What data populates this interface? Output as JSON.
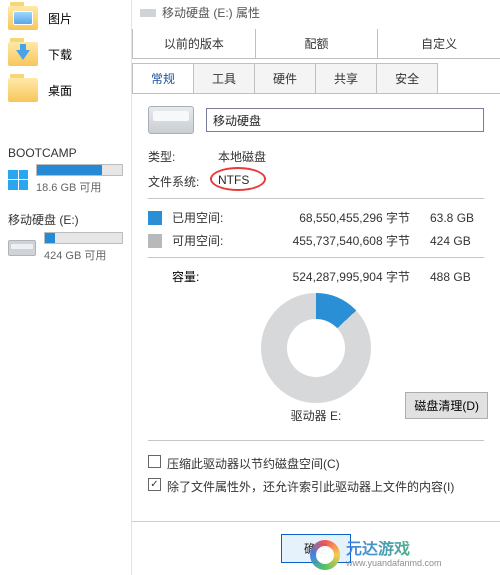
{
  "sidebar": {
    "items": [
      {
        "label": "图片"
      },
      {
        "label": "下载"
      },
      {
        "label": "桌面"
      }
    ],
    "drives": [
      {
        "name": "BOOTCAMP",
        "free_text": "18.6 GB 可用",
        "used_pct": 76,
        "os": true
      },
      {
        "name": "移动硬盘 (E:)",
        "free_text": "424 GB 可用",
        "used_pct": 13,
        "selected": true
      }
    ]
  },
  "dialog": {
    "title": "移动硬盘 (E:) 属性",
    "tabs_top": [
      "以前的版本",
      "配额",
      "自定义"
    ],
    "tabs_bottom": [
      "常规",
      "工具",
      "硬件",
      "共享",
      "安全"
    ],
    "active_tab": "常规",
    "volume_name": "移动硬盘",
    "type_label": "类型:",
    "type_value": "本地磁盘",
    "fs_label": "文件系统:",
    "fs_value": "NTFS",
    "used_label": "已用空间:",
    "used_bytes": "68,550,455,296 字节",
    "used_size": "63.8 GB",
    "free_label": "可用空间:",
    "free_bytes": "455,737,540,608 字节",
    "free_size": "424 GB",
    "capacity_label": "容量:",
    "capacity_bytes": "524,287,995,904 字节",
    "capacity_size": "488 GB",
    "drive_letter": "驱动器 E:",
    "clean_btn": "磁盘清理(D)",
    "chk1": "压缩此驱动器以节约磁盘空间(C)",
    "chk2": "除了文件属性外，还允许索引此驱动器上文件的内容(I)",
    "chk1_checked": false,
    "chk2_checked": true,
    "ok_btn": "确定"
  },
  "watermark": {
    "brand": "元达游戏",
    "url": "www.yuandafanmd.com"
  },
  "chart_data": {
    "type": "pie",
    "title": "驱动器 E:",
    "series": [
      {
        "name": "已用空间",
        "value": 68550455296,
        "display": "63.8 GB",
        "color": "#2b8fd6"
      },
      {
        "name": "可用空间",
        "value": 455737540608,
        "display": "424 GB",
        "color": "#d7d8d9"
      }
    ],
    "total": {
      "name": "容量",
      "value": 524287995904,
      "display": "488 GB"
    }
  }
}
